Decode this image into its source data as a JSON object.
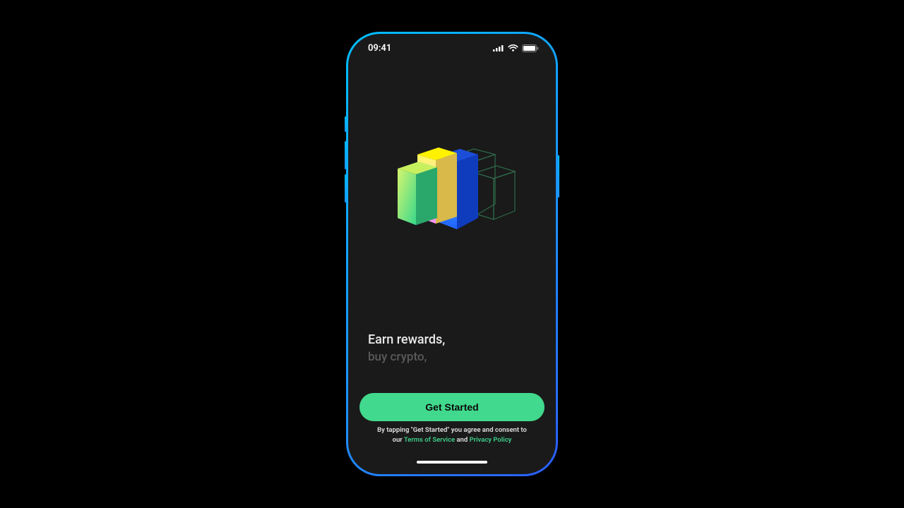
{
  "status": {
    "time": "09:41"
  },
  "tagline": {
    "primary": "Earn rewards,",
    "secondary": "buy crypto,"
  },
  "cta": {
    "label": "Get Started"
  },
  "legal": {
    "prefix": "By tapping \"Get Started\" you agree and consent to our ",
    "terms": "Terms of Service",
    "and": " and ",
    "privacy": "Privacy Policy"
  }
}
